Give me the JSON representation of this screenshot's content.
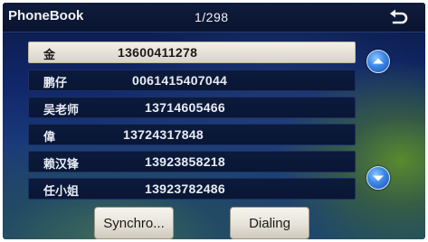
{
  "header": {
    "title": "PhoneBook",
    "page_counter": "1/298"
  },
  "contacts": [
    {
      "name": "金",
      "number": "13600411278",
      "selected": true
    },
    {
      "name": "鹏仔",
      "number": "0061415407044",
      "selected": false
    },
    {
      "name": "吴老师",
      "number": "13714605466",
      "selected": false
    },
    {
      "name": "偉",
      "number": "13724317848",
      "selected": false
    },
    {
      "name": "赖汉锋",
      "number": "13923858218",
      "selected": false
    },
    {
      "name": "任小姐",
      "number": "13923782486",
      "selected": false
    }
  ],
  "buttons": {
    "synchro_label": "Synchro...",
    "dialing_label": "Dialing"
  },
  "icons": {
    "back": "back-arrow-icon",
    "scroll_up": "chevron-up-icon",
    "scroll_down": "chevron-down-icon"
  },
  "colors": {
    "accent_blue": "#3b86e6",
    "selected_row": "#e8e3d9"
  }
}
